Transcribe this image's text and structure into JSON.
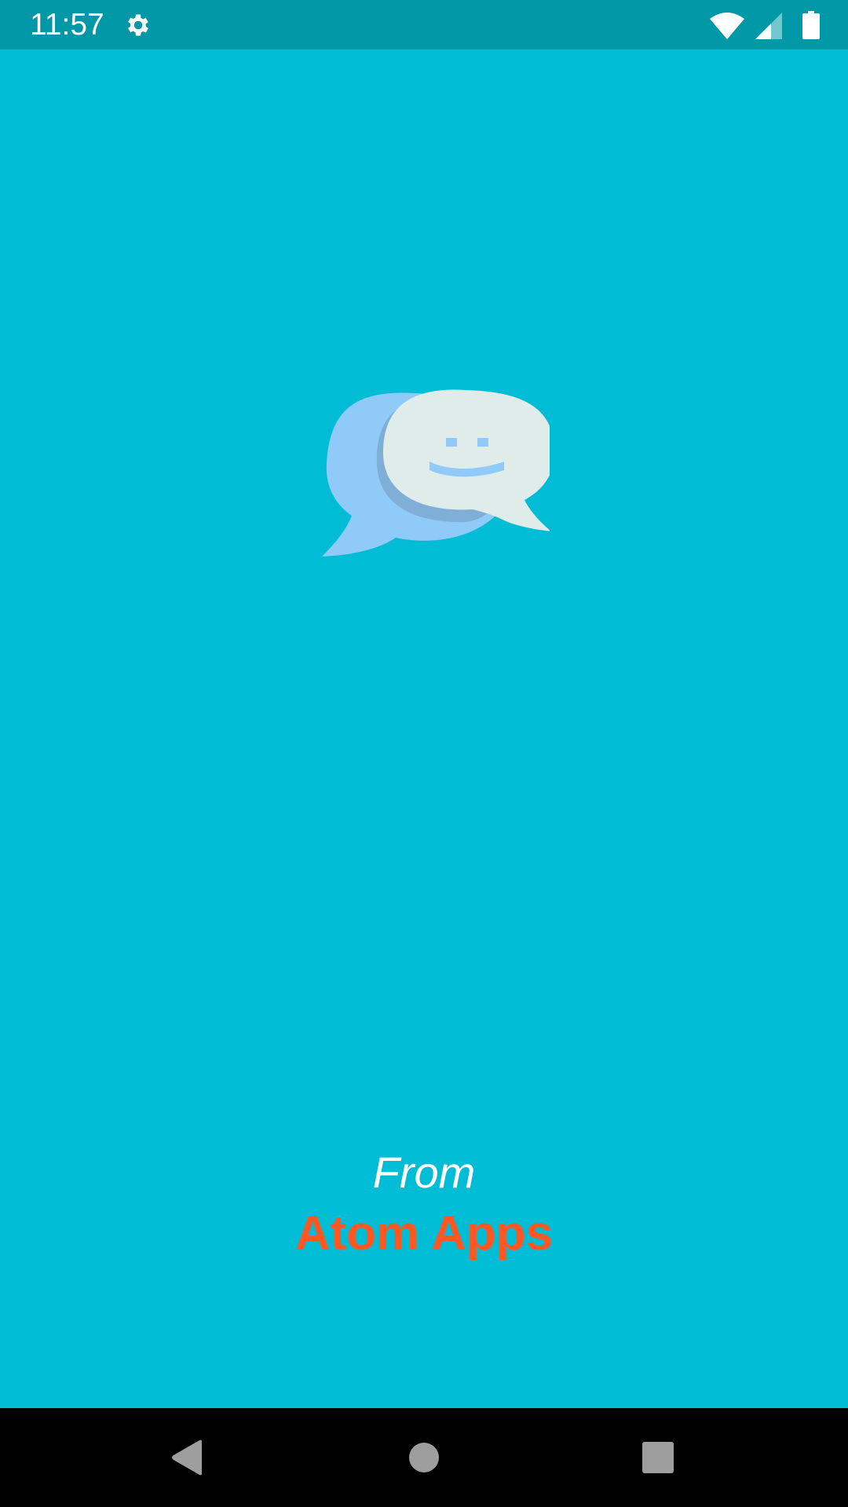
{
  "status_bar": {
    "time": "11:57",
    "icons": [
      "gear-icon",
      "wifi-icon",
      "signal-icon",
      "battery-icon"
    ],
    "background": "#0097A7"
  },
  "splash": {
    "background": "#00BCD4",
    "logo": "chat-bubbles-smiley-icon",
    "from_label": "From",
    "brand_name": "Atom Apps",
    "brand_color": "#FF5722"
  },
  "nav_bar": {
    "buttons": [
      "back-icon",
      "home-icon",
      "recents-icon"
    ]
  }
}
